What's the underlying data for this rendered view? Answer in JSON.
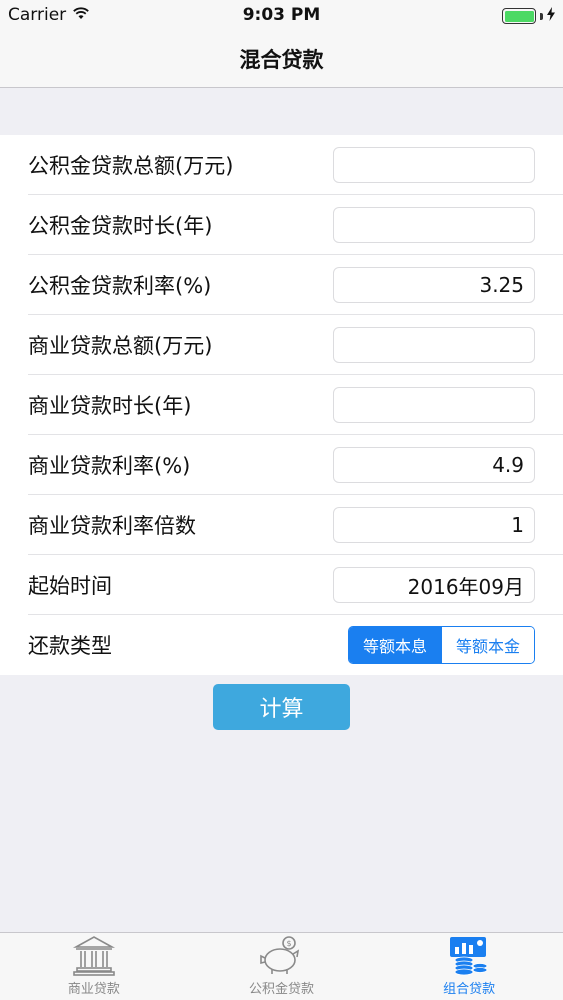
{
  "status_bar": {
    "carrier": "Carrier",
    "time": "9:03 PM",
    "battery_color": "#4cd964"
  },
  "nav": {
    "title": "混合贷款"
  },
  "form": {
    "rows": [
      {
        "label": "公积金贷款总额(万元)",
        "value": ""
      },
      {
        "label": "公积金贷款时长(年)",
        "value": ""
      },
      {
        "label": "公积金贷款利率(%)",
        "value": "3.25"
      },
      {
        "label": "商业贷款总额(万元)",
        "value": ""
      },
      {
        "label": "商业贷款时长(年)",
        "value": ""
      },
      {
        "label": "商业贷款利率(%)",
        "value": "4.9"
      },
      {
        "label": "商业贷款利率倍数",
        "value": "1"
      },
      {
        "label": "起始时间",
        "value": "2016年09月"
      }
    ],
    "repayment": {
      "label": "还款类型",
      "options": [
        "等额本息",
        "等额本金"
      ],
      "selected": "等额本息"
    }
  },
  "calc_button": {
    "label": "计算",
    "color": "#3ea8de"
  },
  "tab_bar": {
    "tabs": [
      {
        "label": "商业贷款",
        "icon": "bank-icon"
      },
      {
        "label": "公积金贷款",
        "icon": "piggy-bank-icon"
      },
      {
        "label": "组合贷款",
        "icon": "coins-chart-icon"
      }
    ],
    "active": "组合贷款",
    "accent_color": "#1a7ff0"
  }
}
